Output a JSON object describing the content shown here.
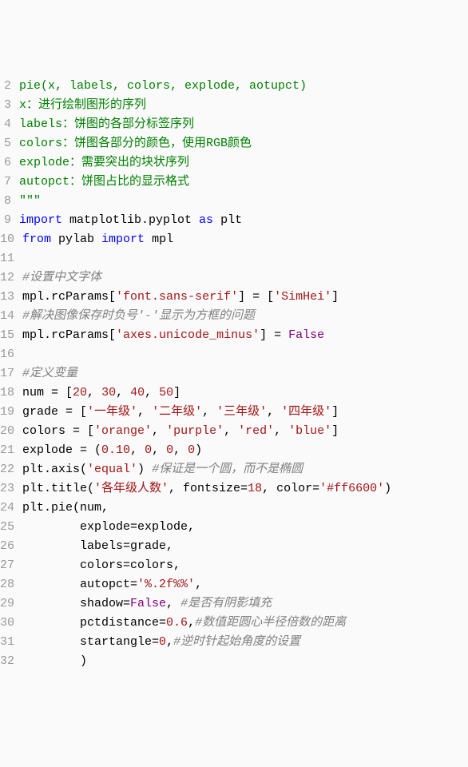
{
  "lines": [
    {
      "n": 2,
      "tokens": [
        {
          "t": "pie(x, labels, colors, explode, aotupct)",
          "c": "c-green"
        }
      ]
    },
    {
      "n": 3,
      "tokens": [
        {
          "t": "x：进行绘制图形的序列",
          "c": "c-green"
        }
      ]
    },
    {
      "n": 4,
      "tokens": [
        {
          "t": "labels：饼图的各部分标签序列",
          "c": "c-green"
        }
      ]
    },
    {
      "n": 5,
      "tokens": [
        {
          "t": "colors：饼图各部分的颜色，使用RGB颜色",
          "c": "c-green"
        }
      ]
    },
    {
      "n": 6,
      "tokens": [
        {
          "t": "explode：需要突出的块状序列",
          "c": "c-green"
        }
      ]
    },
    {
      "n": 7,
      "tokens": [
        {
          "t": "autopct：饼图占比的显示格式",
          "c": "c-green"
        }
      ]
    },
    {
      "n": 8,
      "tokens": [
        {
          "t": "\"\"\"",
          "c": "c-green"
        }
      ]
    },
    {
      "n": 9,
      "tokens": [
        {
          "t": "import",
          "c": "c-kw"
        },
        {
          "t": " matplotlib.pyplot ",
          "c": ""
        },
        {
          "t": "as",
          "c": "c-kw"
        },
        {
          "t": " plt",
          "c": ""
        }
      ]
    },
    {
      "n": 10,
      "tokens": [
        {
          "t": "from",
          "c": "c-kw"
        },
        {
          "t": " pylab ",
          "c": ""
        },
        {
          "t": "import",
          "c": "c-kw"
        },
        {
          "t": " mpl",
          "c": ""
        }
      ]
    },
    {
      "n": 11,
      "tokens": [
        {
          "t": "",
          "c": ""
        }
      ]
    },
    {
      "n": 12,
      "tokens": [
        {
          "t": "#设置中文字体",
          "c": "c-cmt"
        }
      ]
    },
    {
      "n": 13,
      "tokens": [
        {
          "t": "mpl.rcParams[",
          "c": ""
        },
        {
          "t": "'font.sans-serif'",
          "c": "c-str"
        },
        {
          "t": "] = [",
          "c": ""
        },
        {
          "t": "'SimHei'",
          "c": "c-str"
        },
        {
          "t": "]",
          "c": ""
        }
      ]
    },
    {
      "n": 14,
      "tokens": [
        {
          "t": "#解决图像保存时负号'-'显示为方框的问题",
          "c": "c-cmt"
        }
      ]
    },
    {
      "n": 15,
      "tokens": [
        {
          "t": "mpl.rcParams[",
          "c": ""
        },
        {
          "t": "'axes.unicode_minus'",
          "c": "c-str"
        },
        {
          "t": "] = ",
          "c": ""
        },
        {
          "t": "False",
          "c": "c-false"
        }
      ]
    },
    {
      "n": 16,
      "tokens": [
        {
          "t": "",
          "c": ""
        }
      ]
    },
    {
      "n": 17,
      "tokens": [
        {
          "t": "#定义变量",
          "c": "c-cmt"
        }
      ]
    },
    {
      "n": 18,
      "tokens": [
        {
          "t": "num = [",
          "c": ""
        },
        {
          "t": "20",
          "c": "c-num"
        },
        {
          "t": ", ",
          "c": ""
        },
        {
          "t": "30",
          "c": "c-num"
        },
        {
          "t": ", ",
          "c": ""
        },
        {
          "t": "40",
          "c": "c-num"
        },
        {
          "t": ", ",
          "c": ""
        },
        {
          "t": "50",
          "c": "c-num"
        },
        {
          "t": "]",
          "c": ""
        }
      ]
    },
    {
      "n": 19,
      "tokens": [
        {
          "t": "grade = [",
          "c": ""
        },
        {
          "t": "'一年级'",
          "c": "c-str"
        },
        {
          "t": ", ",
          "c": ""
        },
        {
          "t": "'二年级'",
          "c": "c-str"
        },
        {
          "t": ", ",
          "c": ""
        },
        {
          "t": "'三年级'",
          "c": "c-str"
        },
        {
          "t": ", ",
          "c": ""
        },
        {
          "t": "'四年级'",
          "c": "c-str"
        },
        {
          "t": "]",
          "c": ""
        }
      ]
    },
    {
      "n": 20,
      "tokens": [
        {
          "t": "colors = [",
          "c": ""
        },
        {
          "t": "'orange'",
          "c": "c-str"
        },
        {
          "t": ", ",
          "c": ""
        },
        {
          "t": "'purple'",
          "c": "c-str"
        },
        {
          "t": ", ",
          "c": ""
        },
        {
          "t": "'red'",
          "c": "c-str"
        },
        {
          "t": ", ",
          "c": ""
        },
        {
          "t": "'blue'",
          "c": "c-str"
        },
        {
          "t": "]",
          "c": ""
        }
      ]
    },
    {
      "n": 21,
      "tokens": [
        {
          "t": "explode = (",
          "c": ""
        },
        {
          "t": "0.10",
          "c": "c-num"
        },
        {
          "t": ", ",
          "c": ""
        },
        {
          "t": "0",
          "c": "c-num"
        },
        {
          "t": ", ",
          "c": ""
        },
        {
          "t": "0",
          "c": "c-num"
        },
        {
          "t": ", ",
          "c": ""
        },
        {
          "t": "0",
          "c": "c-num"
        },
        {
          "t": ")",
          "c": ""
        }
      ]
    },
    {
      "n": 22,
      "tokens": [
        {
          "t": "plt.axis(",
          "c": ""
        },
        {
          "t": "'equal'",
          "c": "c-str"
        },
        {
          "t": ") ",
          "c": ""
        },
        {
          "t": "#保证是一个圆，而不是椭圆",
          "c": "c-cmt"
        }
      ]
    },
    {
      "n": 23,
      "tokens": [
        {
          "t": "plt.title(",
          "c": ""
        },
        {
          "t": "'各年级人数'",
          "c": "c-str"
        },
        {
          "t": ", fontsize=",
          "c": ""
        },
        {
          "t": "18",
          "c": "c-num"
        },
        {
          "t": ", color=",
          "c": ""
        },
        {
          "t": "'#ff6600'",
          "c": "c-str"
        },
        {
          "t": ")",
          "c": ""
        }
      ]
    },
    {
      "n": 24,
      "tokens": [
        {
          "t": "plt.pie(num,",
          "c": ""
        }
      ]
    },
    {
      "n": 25,
      "tokens": [
        {
          "t": "        explode=explode,",
          "c": ""
        }
      ]
    },
    {
      "n": 26,
      "tokens": [
        {
          "t": "        labels=grade,",
          "c": ""
        }
      ]
    },
    {
      "n": 27,
      "tokens": [
        {
          "t": "        colors=colors,",
          "c": ""
        }
      ]
    },
    {
      "n": 28,
      "tokens": [
        {
          "t": "        autopct=",
          "c": ""
        },
        {
          "t": "'%.2f%%'",
          "c": "c-str"
        },
        {
          "t": ",",
          "c": ""
        }
      ]
    },
    {
      "n": 29,
      "tokens": [
        {
          "t": "        shadow=",
          "c": ""
        },
        {
          "t": "False",
          "c": "c-false"
        },
        {
          "t": ", ",
          "c": ""
        },
        {
          "t": "#是否有阴影填充",
          "c": "c-cmt"
        }
      ]
    },
    {
      "n": 30,
      "tokens": [
        {
          "t": "        pctdistance=",
          "c": ""
        },
        {
          "t": "0.6",
          "c": "c-num"
        },
        {
          "t": ",",
          "c": ""
        },
        {
          "t": "#数值距圆心半径倍数的距离",
          "c": "c-cmt"
        }
      ]
    },
    {
      "n": 31,
      "tokens": [
        {
          "t": "        startangle=",
          "c": ""
        },
        {
          "t": "0",
          "c": "c-num"
        },
        {
          "t": ",",
          "c": ""
        },
        {
          "t": "#逆时针起始角度的设置",
          "c": "c-cmt"
        }
      ]
    },
    {
      "n": 32,
      "tokens": [
        {
          "t": "        )",
          "c": ""
        }
      ]
    }
  ]
}
